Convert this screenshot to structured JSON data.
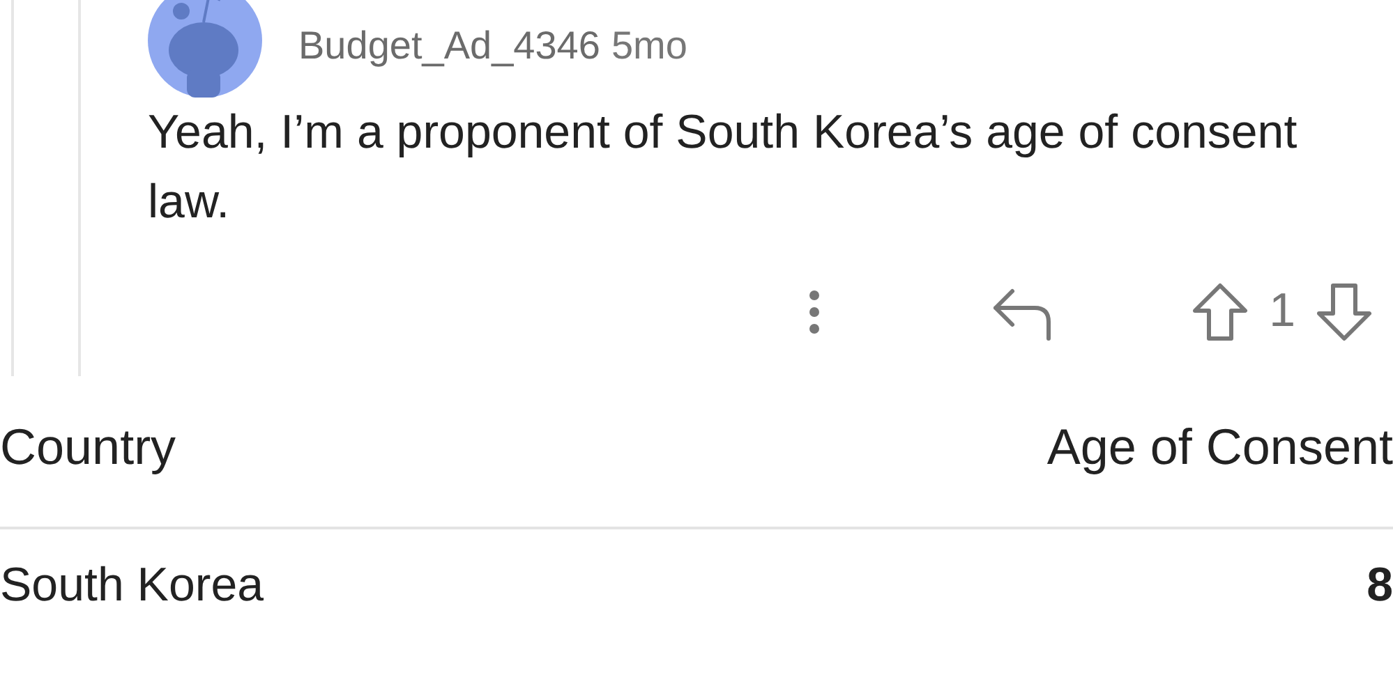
{
  "comment": {
    "author": "Budget_Ad_4346",
    "age": "5mo",
    "body": "Yeah, I’m a proponent of South Korea’s age of consent law.",
    "score": "1"
  },
  "table": {
    "columns": [
      "Country",
      "Age of Consent"
    ],
    "rows": [
      {
        "country": "South Korea",
        "age": "8"
      }
    ]
  }
}
